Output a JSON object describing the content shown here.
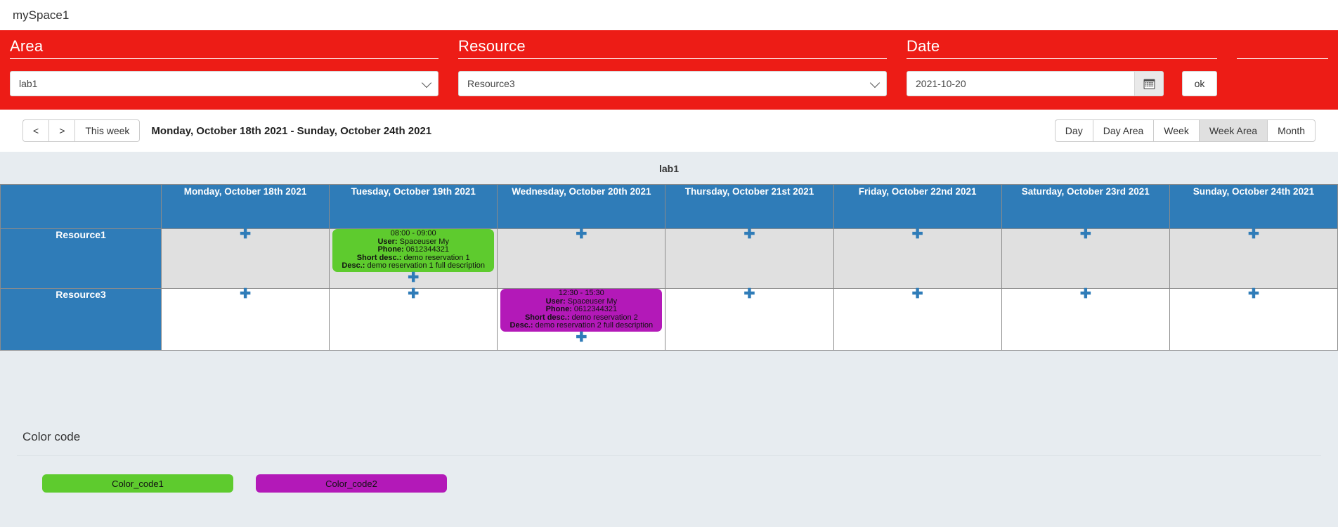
{
  "app": {
    "title": "mySpace1"
  },
  "filters": {
    "area": {
      "label": "Area",
      "value": "lab1",
      "icon": "chevron-down-icon"
    },
    "resource": {
      "label": "Resource",
      "value": "Resource3",
      "icon": "chevron-down-icon"
    },
    "date": {
      "label": "Date",
      "value": "2021-10-20",
      "placeholder": "yyyy-mm-dd",
      "picker_icon": "calendar-icon"
    },
    "submit": {
      "label": "ok"
    }
  },
  "nav": {
    "prev_label": "<",
    "next_label": ">",
    "this_week_label": "This week",
    "range_title": "Monday, October 18th 2021 - Sunday, October 24th 2021",
    "views": [
      {
        "label": "Day",
        "active": false
      },
      {
        "label": "Day Area",
        "active": false
      },
      {
        "label": "Week",
        "active": false
      },
      {
        "label": "Week Area",
        "active": true
      },
      {
        "label": "Month",
        "active": false
      }
    ]
  },
  "calendar": {
    "area_caption": "lab1",
    "add_icon": "plus-icon",
    "day_headers": [
      "Monday, October 18th 2021",
      "Tuesday, October 19th 2021",
      "Wednesday, October 20th 2021",
      "Thursday, October 21st 2021",
      "Friday, October 22nd 2021",
      "Saturday, October 23rd 2021",
      "Sunday, October 24th 2021"
    ],
    "rows": [
      {
        "resource": "Resource1",
        "cells": [
          {
            "reservations": []
          },
          {
            "reservations": [
              {
                "time": "08:00 - 09:00",
                "user_label": "User:",
                "user": "Spaceuser My",
                "phone_label": "Phone:",
                "phone": "0612344321",
                "short_label": "Short desc.:",
                "short": "demo reservation 1",
                "desc_label": "Desc.:",
                "desc": "demo reservation 1 full description",
                "color": "#5ecb2e"
              }
            ]
          },
          {
            "reservations": []
          },
          {
            "reservations": []
          },
          {
            "reservations": []
          },
          {
            "reservations": []
          },
          {
            "reservations": []
          }
        ]
      },
      {
        "resource": "Resource3",
        "cells": [
          {
            "reservations": []
          },
          {
            "reservations": []
          },
          {
            "reservations": [
              {
                "time": "12:30 - 15:30",
                "user_label": "User:",
                "user": "Spaceuser My",
                "phone_label": "Phone:",
                "phone": "0612344321",
                "short_label": "Short desc.:",
                "short": "demo reservation 2",
                "desc_label": "Desc.:",
                "desc": "demo reservation 2 full description",
                "color": "#b319b8"
              }
            ]
          },
          {
            "reservations": []
          },
          {
            "reservations": []
          },
          {
            "reservations": []
          },
          {
            "reservations": []
          }
        ]
      }
    ]
  },
  "legend": {
    "title": "Color code",
    "items": [
      {
        "label": "Color_code1",
        "color": "#5ecb2e"
      },
      {
        "label": "Color_code2",
        "color": "#b319b8"
      }
    ]
  },
  "theme": {
    "brand_red": "#ed1c16",
    "header_blue": "#2f7cb8",
    "page_bg": "#e7ecf0"
  }
}
